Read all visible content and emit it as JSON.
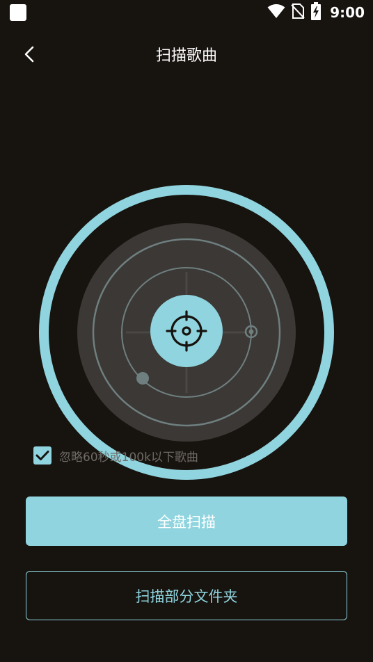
{
  "status_bar": {
    "time": "9:00",
    "icons": [
      "notification-square-icon",
      "wifi-icon",
      "no-sim-icon",
      "battery-charging-icon"
    ]
  },
  "header": {
    "back_icon": "back-chevron-icon",
    "title": "扫描歌曲"
  },
  "radar": {
    "center_icon": "crosshair-target-icon"
  },
  "filter": {
    "checked": true,
    "label": "忽略60秒或100k以下歌曲"
  },
  "actions": {
    "full_scan_label": "全盘扫描",
    "partial_scan_label": "扫描部分文件夹"
  },
  "colors": {
    "accent": "#8fd4de",
    "background": "#17130f",
    "radar_disc": "#3b3835",
    "radar_lines": "#6f7f80"
  }
}
